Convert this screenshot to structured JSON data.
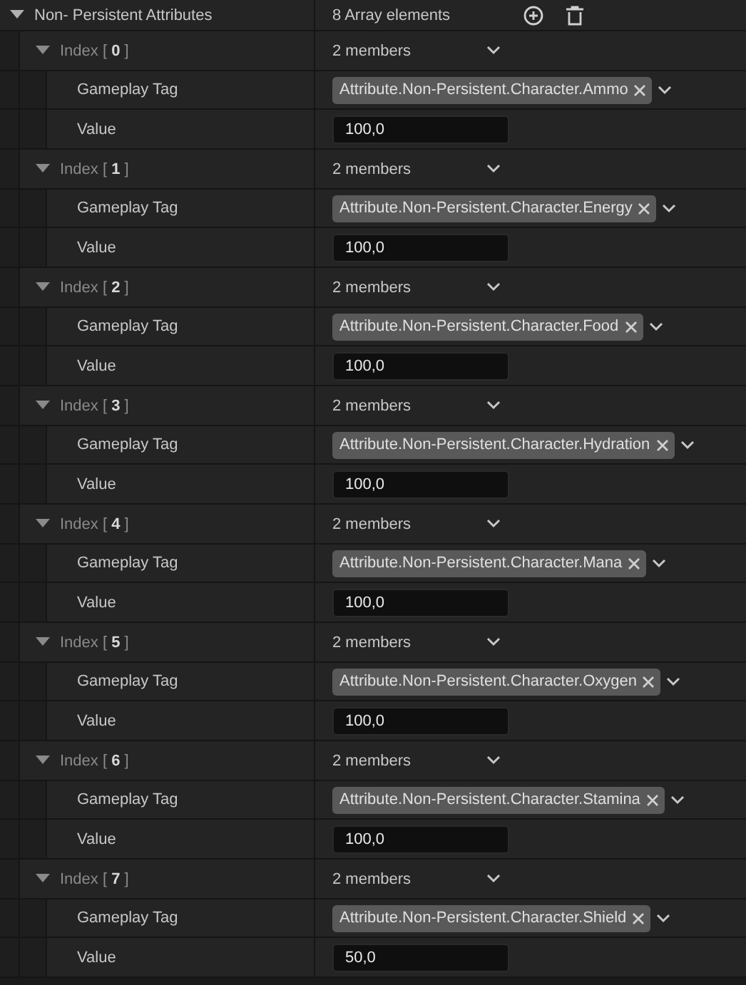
{
  "array": {
    "label": "Non- Persistent Attributes",
    "expanded": true,
    "count": "8 Array elements"
  },
  "elements": [
    {
      "index": "Index [ **0** ]",
      "expanded": true,
      "members": "2 members",
      "tag_label": "Gameplay Tag",
      "tag": "Attribute.Non-Persistent.Character.Ammo",
      "value_label": "Value",
      "value": "100,0"
    },
    {
      "index": "Index [ **1** ]",
      "expanded": true,
      "members": "2 members",
      "tag_label": "Gameplay Tag",
      "tag": "Attribute.Non-Persistent.Character.Energy",
      "value_label": "Value",
      "value": "100,0"
    },
    {
      "index": "Index [ **2** ]",
      "expanded": true,
      "members": "2 members",
      "tag_label": "Gameplay Tag",
      "tag": "Attribute.Non-Persistent.Character.Food",
      "value_label": "Value",
      "value": "100,0"
    },
    {
      "index": "Index [ **3** ]",
      "expanded": true,
      "members": "2 members",
      "tag_label": "Gameplay Tag",
      "tag": "Attribute.Non-Persistent.Character.Hydration",
      "value_label": "Value",
      "value": "100,0"
    },
    {
      "index": "Index [ **4** ]",
      "expanded": true,
      "members": "2 members",
      "tag_label": "Gameplay Tag",
      "tag": "Attribute.Non-Persistent.Character.Mana",
      "value_label": "Value",
      "value": "100,0"
    },
    {
      "index": "Index [ **5** ]",
      "expanded": true,
      "members": "2 members",
      "tag_label": "Gameplay Tag",
      "tag": "Attribute.Non-Persistent.Character.Oxygen",
      "value_label": "Value",
      "value": "100,0"
    },
    {
      "index": "Index [ **6** ]",
      "expanded": true,
      "members": "2 members",
      "tag_label": "Gameplay Tag",
      "tag": "Attribute.Non-Persistent.Character.Stamina",
      "value_label": "Value",
      "value": "100,0"
    },
    {
      "index": "Index [ **7** ]",
      "expanded": true,
      "members": "2 members",
      "tag_label": "Gameplay Tag",
      "tag": "Attribute.Non-Persistent.Character.Shield",
      "value_label": "Value",
      "value": "50,0"
    }
  ]
}
